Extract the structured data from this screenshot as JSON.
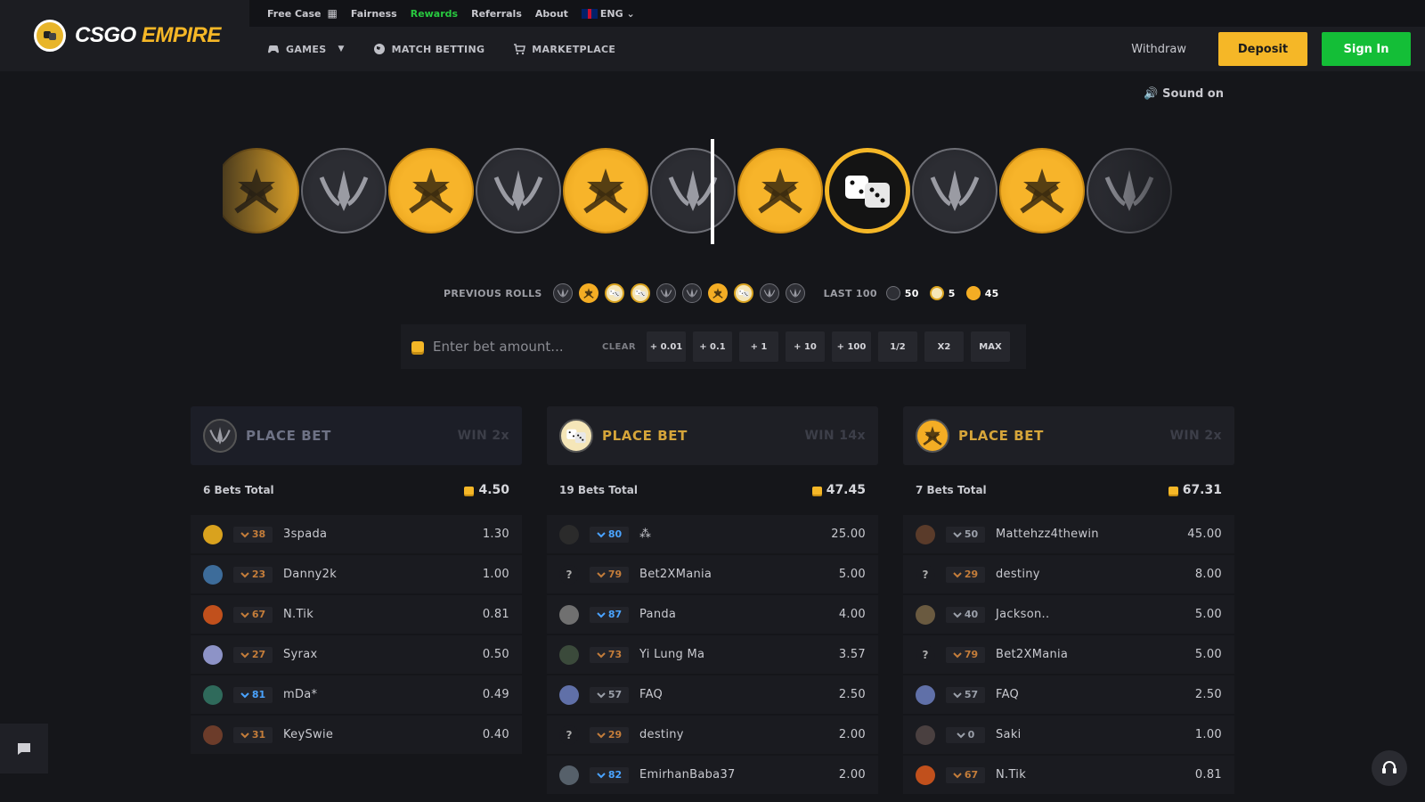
{
  "brand": {
    "name_a": "CSGO",
    "name_b": "EMPIRE"
  },
  "topbar": {
    "items": [
      "Free Case",
      "Fairness",
      "Rewards",
      "Referrals",
      "About"
    ],
    "lang": "ENG"
  },
  "nav": {
    "games": "GAMES",
    "match": "MATCH BETTING",
    "market": "MARKETPLACE",
    "withdraw": "Withdraw",
    "deposit": "Deposit",
    "signin": "Sign In"
  },
  "sound": "Sound on",
  "roulette": {
    "strip": [
      "t",
      "ct",
      "t",
      "ct",
      "t",
      "ct",
      "t",
      "dice",
      "ct",
      "t",
      "ct"
    ]
  },
  "history": {
    "label": "PREVIOUS ROLLS",
    "rolls": [
      "ct",
      "t",
      "dice",
      "dice",
      "ct",
      "ct",
      "t",
      "dice",
      "ct",
      "ct"
    ],
    "last_label": "LAST 100",
    "ct_count": "50",
    "dice_count": "5",
    "t_count": "45"
  },
  "bet": {
    "placeholder": "Enter bet amount...",
    "clear": "CLEAR",
    "quick": [
      "+ 0.01",
      "+ 0.1",
      "+ 1",
      "+ 10",
      "+ 100",
      "1/2",
      "X2",
      "MAX"
    ]
  },
  "columns": [
    {
      "place": "PLACE BET",
      "win": "WIN 2x",
      "total_label": "6 Bets Total",
      "total_value": "4.50",
      "rows": [
        {
          "level": "38",
          "tier": "o",
          "name": "3spada",
          "amount": "1.30",
          "avatar": "#d9a21e"
        },
        {
          "level": "23",
          "tier": "o",
          "name": "Danny2k",
          "amount": "1.00",
          "avatar": "#3d6c9a"
        },
        {
          "level": "67",
          "tier": "o",
          "name": "N.Tik",
          "amount": "0.81",
          "avatar": "#c1501c"
        },
        {
          "level": "27",
          "tier": "o",
          "name": "Syrax",
          "amount": "0.50",
          "avatar": "#8d93c7"
        },
        {
          "level": "81",
          "tier": "b",
          "name": "mDa*",
          "amount": "0.49",
          "avatar": "#2f6a5b"
        },
        {
          "level": "31",
          "tier": "o",
          "name": "KeySwie",
          "amount": "0.40",
          "avatar": "#6c3c2a"
        }
      ]
    },
    {
      "place": "PLACE BET",
      "win": "WIN 14x",
      "total_label": "19 Bets Total",
      "total_value": "47.45",
      "rows": [
        {
          "level": "80",
          "tier": "b",
          "name": "⁂",
          "amount": "25.00",
          "avatar": "#2b2b2b"
        },
        {
          "level": "79",
          "tier": "o",
          "name": "Bet2XMania",
          "amount": "5.00",
          "avatar": "q"
        },
        {
          "level": "87",
          "tier": "b",
          "name": "Panda",
          "amount": "4.00",
          "avatar": "#707070"
        },
        {
          "level": "73",
          "tier": "o",
          "name": "Yi Lung Ma",
          "amount": "3.57",
          "avatar": "#3b4a3b"
        },
        {
          "level": "57",
          "tier": "g",
          "name": "FAQ",
          "amount": "2.50",
          "avatar": "#6070a8"
        },
        {
          "level": "29",
          "tier": "o",
          "name": "destiny",
          "amount": "2.00",
          "avatar": "q"
        },
        {
          "level": "82",
          "tier": "b",
          "name": "EmirhanBaba37",
          "amount": "2.00",
          "avatar": "#56606a"
        }
      ]
    },
    {
      "place": "PLACE BET",
      "win": "WIN 2x",
      "total_label": "7 Bets Total",
      "total_value": "67.31",
      "rows": [
        {
          "level": "50",
          "tier": "g",
          "name": "Mattehzz4thewin",
          "amount": "45.00",
          "avatar": "#5a3b2a"
        },
        {
          "level": "29",
          "tier": "o",
          "name": "destiny",
          "amount": "8.00",
          "avatar": "q"
        },
        {
          "level": "40",
          "tier": "g",
          "name": "Jackson..",
          "amount": "5.00",
          "avatar": "#6a5a40"
        },
        {
          "level": "79",
          "tier": "o",
          "name": "Bet2XMania",
          "amount": "5.00",
          "avatar": "q"
        },
        {
          "level": "57",
          "tier": "g",
          "name": "FAQ",
          "amount": "2.50",
          "avatar": "#6070a8"
        },
        {
          "level": "0",
          "tier": "g",
          "name": "Saki",
          "amount": "1.00",
          "avatar": "#4a4040"
        },
        {
          "level": "67",
          "tier": "o",
          "name": "N.Tik",
          "amount": "0.81",
          "avatar": "#c1501c"
        }
      ]
    }
  ]
}
